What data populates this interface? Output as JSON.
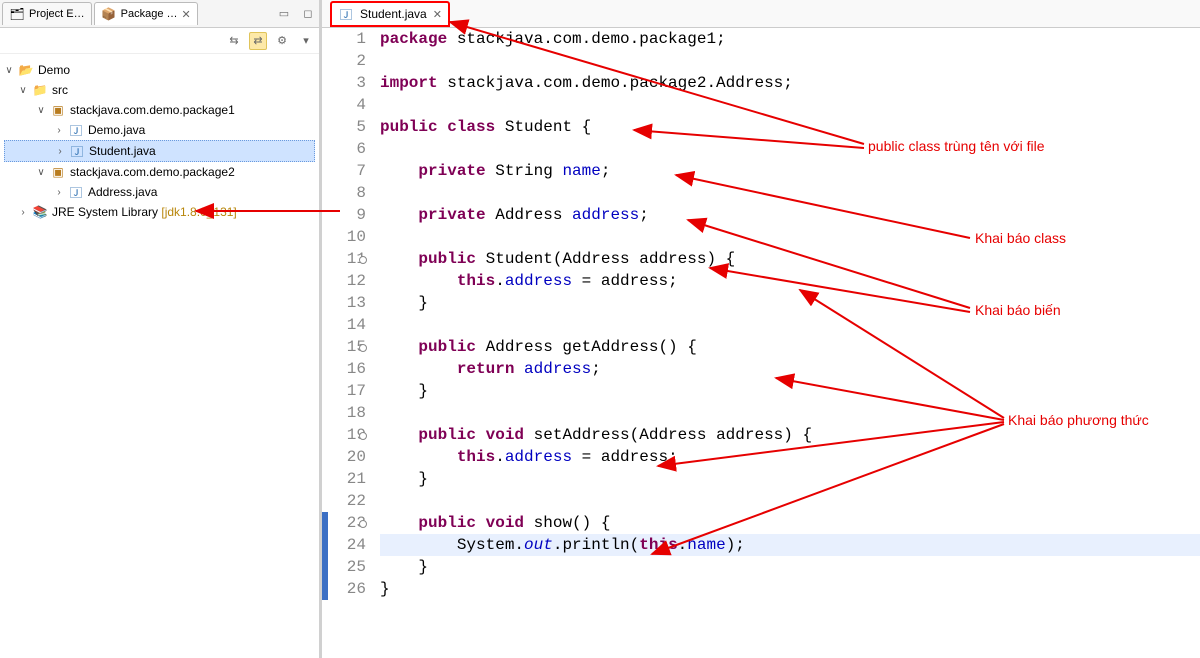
{
  "leftTabs": {
    "projectExplorer": "Project E…",
    "packageExplorer": "Package …"
  },
  "tree": {
    "project": "Demo",
    "src": "src",
    "pkg1": "stackjava.com.demo.package1",
    "file1a": "Demo.java",
    "file1b": "Student.java",
    "pkg2": "stackjava.com.demo.package2",
    "file2a": "Address.java",
    "jre": "JRE System Library",
    "jreExtra": " [jdk1.8.0_131]"
  },
  "editorTab": {
    "title": "Student.java"
  },
  "gutterLines": [
    "1",
    "2",
    "3",
    "4",
    "5",
    "6",
    "7",
    "8",
    "9",
    "10",
    "11",
    "12",
    "13",
    "14",
    "15",
    "16",
    "17",
    "18",
    "19",
    "20",
    "21",
    "22",
    "23",
    "24",
    "25",
    "26"
  ],
  "overrideLines": [
    11,
    15,
    19,
    23
  ],
  "markerLines": [
    23,
    24,
    25,
    26
  ],
  "code": {
    "l1": {
      "a": "package",
      "b": " stackjava.com.demo.package1;"
    },
    "l3": {
      "a": "import",
      "b": " stackjava.com.demo.package2.Address;"
    },
    "l5": {
      "a": "public",
      "b": " ",
      "c": "class",
      "d": " Student {"
    },
    "l7": {
      "a": "    ",
      "b": "private",
      "c": " String ",
      "d": "name",
      "e": ";"
    },
    "l9": {
      "a": "    ",
      "b": "private",
      "c": " Address ",
      "d": "address",
      "e": ";"
    },
    "l11": {
      "a": "    ",
      "b": "public",
      "c": " Student(Address address) {"
    },
    "l12": {
      "a": "        ",
      "b": "this",
      "c": ".",
      "d": "address",
      "e": " = address;"
    },
    "l13": {
      "a": "    }"
    },
    "l15": {
      "a": "    ",
      "b": "public",
      "c": " Address getAddress() {"
    },
    "l16": {
      "a": "        ",
      "b": "return",
      "c": " ",
      "d": "address",
      "e": ";"
    },
    "l17": {
      "a": "    }"
    },
    "l19": {
      "a": "    ",
      "b": "public",
      "c": " ",
      "d": "void",
      "e": " setAddress(Address address) {"
    },
    "l20": {
      "a": "        ",
      "b": "this",
      "c": ".",
      "d": "address",
      "e": " = address;"
    },
    "l21": {
      "a": "    }"
    },
    "l23": {
      "a": "    ",
      "b": "public",
      "c": " ",
      "d": "void",
      "e": " show() {"
    },
    "l24": {
      "a": "        System.",
      "b": "out",
      "c": ".println(",
      "d": "this",
      "e": ".",
      "f": "name",
      "g": ");"
    },
    "l25": {
      "a": "    }"
    },
    "l26": {
      "a": "}"
    }
  },
  "annotations": {
    "a1": "public class trùng tên với file",
    "a2": "Khai báo class",
    "a3": "Khai báo biến",
    "a4": "Khai báo phương thức"
  }
}
